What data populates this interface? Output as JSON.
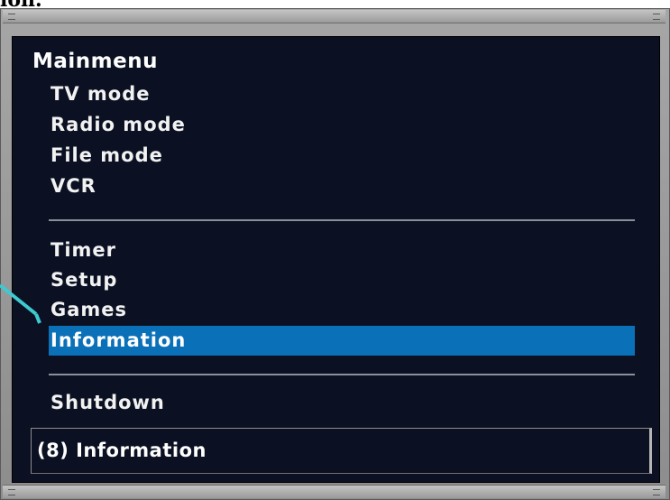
{
  "caption_fragment": "ion.",
  "menu": {
    "title": "Mainmenu",
    "group1": [
      {
        "label": "TV mode"
      },
      {
        "label": "Radio mode"
      },
      {
        "label": "File mode"
      },
      {
        "label": "VCR"
      }
    ],
    "group2": [
      {
        "label": "Timer"
      },
      {
        "label": "Setup"
      },
      {
        "label": "Games"
      },
      {
        "label": "Information",
        "selected": true
      }
    ],
    "group3": [
      {
        "label": "Shutdown"
      }
    ]
  },
  "status": {
    "text": "(8) Information"
  },
  "colors": {
    "screen_background": "#0b1122",
    "selection": "#0a70b8",
    "pointer": "#3ecad0",
    "frame": "#a6a6a6"
  },
  "icons": {
    "pointer": "annotation-arrow-icon"
  }
}
